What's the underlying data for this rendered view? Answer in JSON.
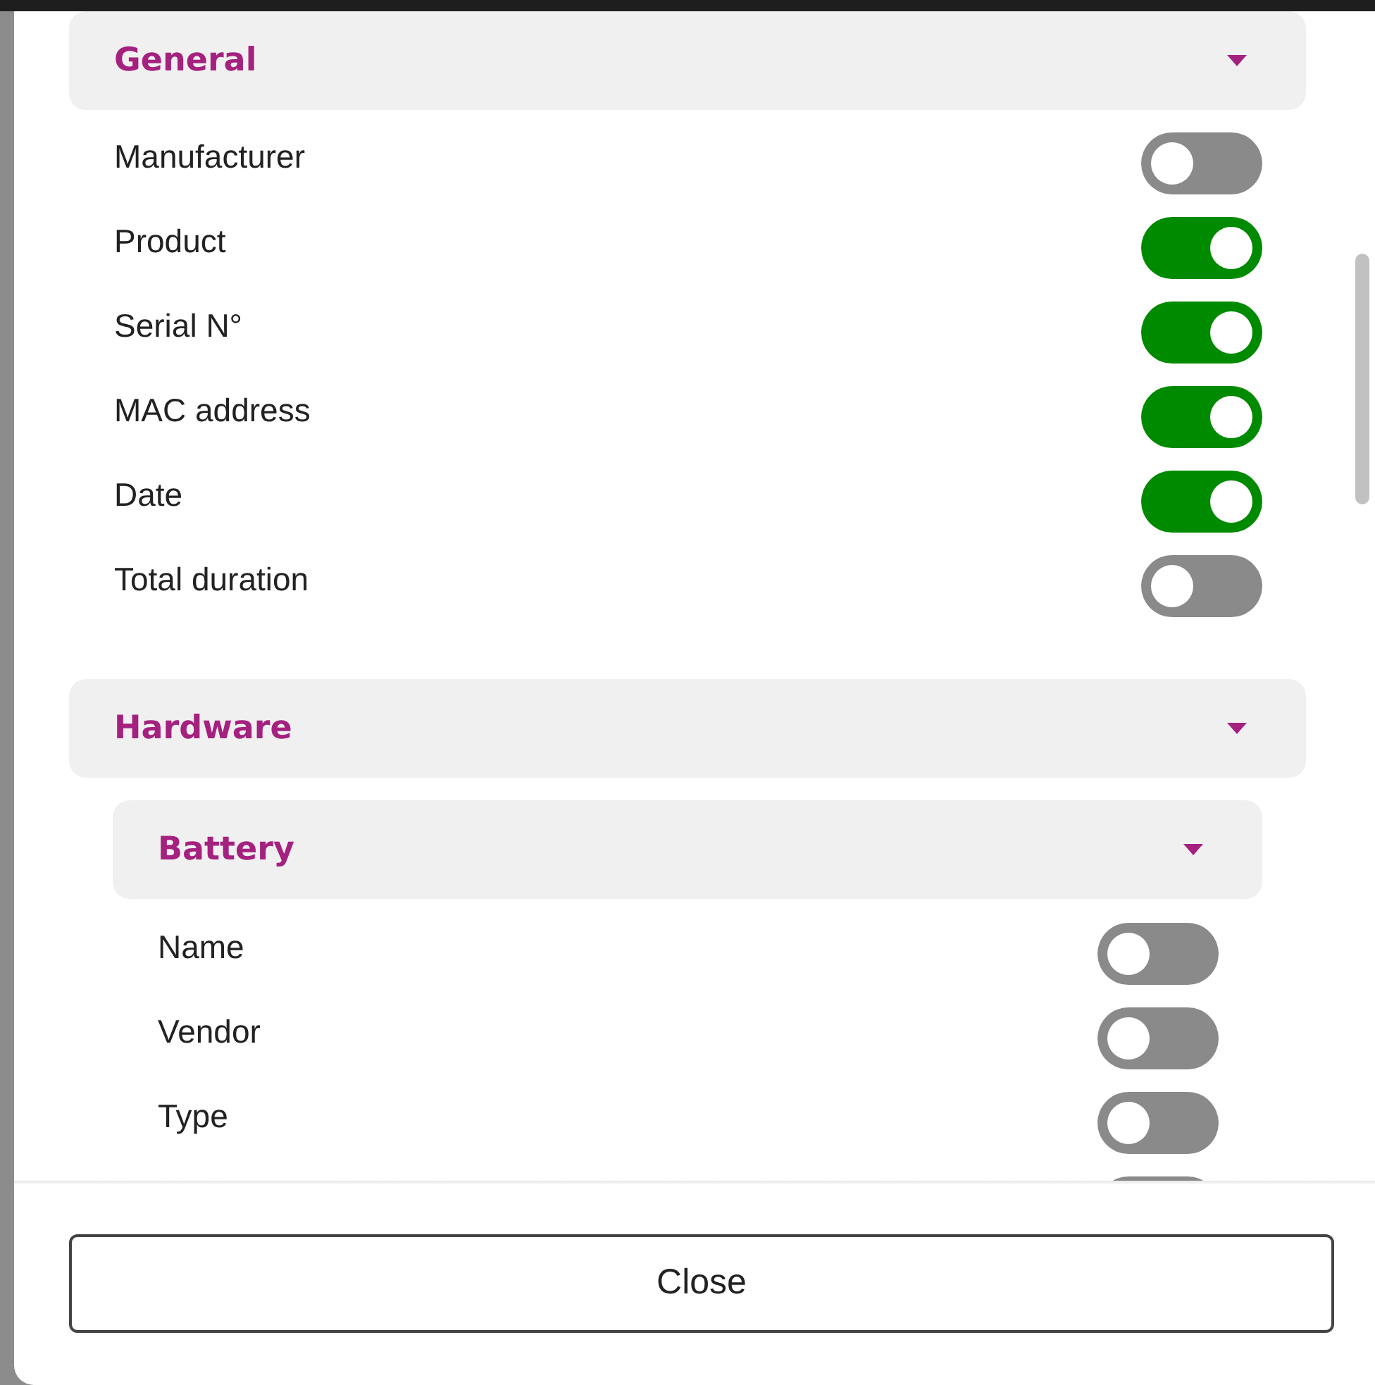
{
  "sections": [
    {
      "title": "General",
      "expanded": true,
      "rows": [
        {
          "label": "Manufacturer",
          "on": false
        },
        {
          "label": "Product",
          "on": true
        },
        {
          "label": "Serial N°",
          "on": true
        },
        {
          "label": "MAC address",
          "on": true
        },
        {
          "label": "Date",
          "on": true
        },
        {
          "label": "Total duration",
          "on": false
        }
      ]
    },
    {
      "title": "Hardware",
      "expanded": true,
      "subsections": [
        {
          "title": "Battery",
          "expanded": true,
          "rows": [
            {
              "label": "Name",
              "on": false
            },
            {
              "label": "Vendor",
              "on": false
            },
            {
              "label": "Type",
              "on": false
            },
            {
              "on": false
            }
          ]
        }
      ]
    }
  ],
  "footer": {
    "button": "Close"
  }
}
